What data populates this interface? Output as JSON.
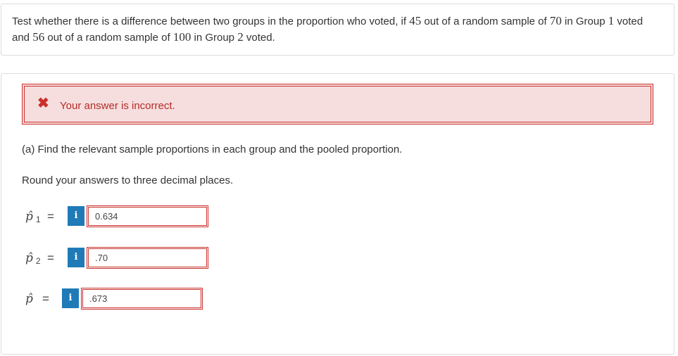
{
  "question": {
    "part1": "Test whether there is a difference between two groups in the proportion who voted, if ",
    "n1_yes": "45",
    "part2": " out of a random sample of ",
    "n1": "70",
    "part3": " in Group ",
    "g1": "1",
    "part4": " voted and ",
    "n2_yes": "56",
    "part5": " out of a random sample of ",
    "n2": "100",
    "part6": " in Group ",
    "g2": "2",
    "part7": " voted."
  },
  "alert": {
    "icon": "x-icon",
    "message": "Your answer is incorrect."
  },
  "part_a": {
    "label": "(a) Find the relevant sample proportions in each group and the pooled proportion.",
    "instruction": "Round your answers to three decimal places."
  },
  "fields": [
    {
      "symbol": "p̂",
      "subscript": "1",
      "equals": "=",
      "info": "i",
      "value": "0.634"
    },
    {
      "symbol": "p̂",
      "subscript": "2",
      "equals": "=",
      "info": "i",
      "value": ".70"
    },
    {
      "symbol": "p̂",
      "subscript": "",
      "equals": "=",
      "info": "i",
      "value": ".673"
    }
  ],
  "colors": {
    "error_border": "#c9302c",
    "error_background": "#f6dede",
    "info_button": "#1f7ab8"
  }
}
